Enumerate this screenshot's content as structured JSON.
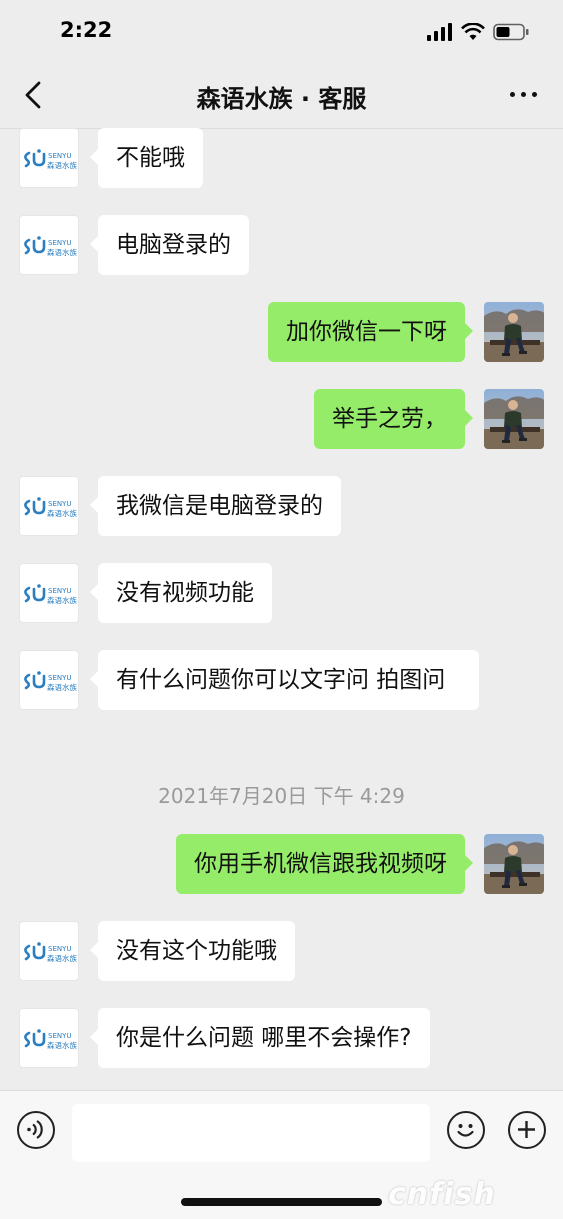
{
  "status_bar": {
    "time": "2:22"
  },
  "nav": {
    "title": "森语水族 · 客服"
  },
  "brand": {
    "logo_top": "SENYU",
    "logo_bottom": "森语水族",
    "accent": "#2b7fc1"
  },
  "messages": [
    {
      "side": "left",
      "text": "不能哦"
    },
    {
      "side": "left",
      "text": "电脑登录的"
    },
    {
      "side": "right",
      "text": "加你微信一下呀"
    },
    {
      "side": "right",
      "text": "举手之劳，"
    },
    {
      "side": "left",
      "text": "我微信是电脑登录的"
    },
    {
      "side": "left",
      "text": "没有视频功能"
    },
    {
      "side": "left",
      "text": "有什么问题你可以文字问 拍图问"
    },
    {
      "side": "right",
      "text": "你用手机微信跟我视频呀"
    },
    {
      "side": "left",
      "text": "没有这个功能哦"
    },
    {
      "side": "left",
      "text": "你是什么问题 哪里不会操作?"
    }
  ],
  "timestamp": "2021年7月20日 下午 4:29",
  "input_bar": {
    "voice_icon": "voice-icon",
    "emoji_icon": "emoji-icon",
    "plus_icon": "plus-icon"
  },
  "watermark": "cnfish",
  "colors": {
    "bg": "#ededed",
    "sent_bubble": "#95ec69",
    "received_bubble": "#ffffff"
  }
}
